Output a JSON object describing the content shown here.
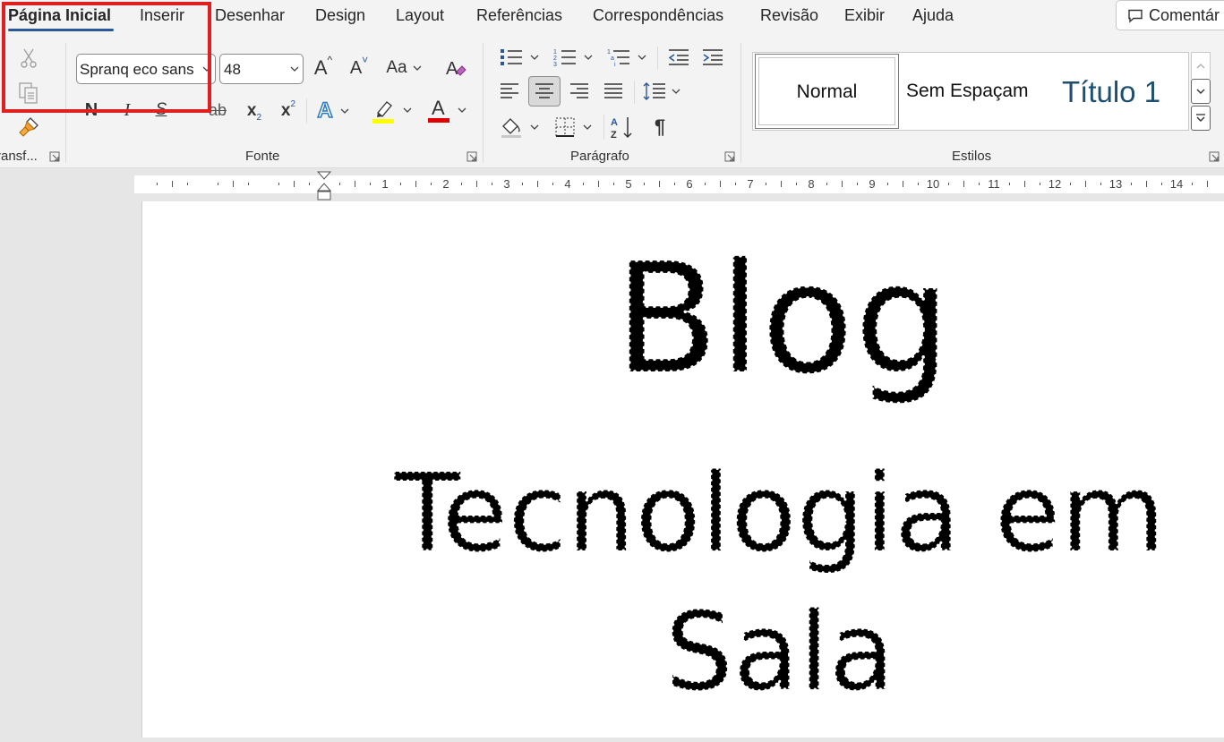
{
  "tabs": [
    {
      "label": "Página Inicial",
      "active": true
    },
    {
      "label": "Inserir"
    },
    {
      "label": "Desenhar"
    },
    {
      "label": "Design"
    },
    {
      "label": "Layout"
    },
    {
      "label": "Referências"
    },
    {
      "label": "Correspondências"
    },
    {
      "label": "Revisão"
    },
    {
      "label": "Exibir"
    },
    {
      "label": "Ajuda"
    }
  ],
  "comments_button": "Comentár",
  "groups": {
    "clipboard": "ransf...",
    "font": "Fonte",
    "paragraph": "Parágrafo",
    "styles": "Estilos"
  },
  "font": {
    "name": "Spranq eco sans",
    "size": "48",
    "grow": "A",
    "shrink": "A",
    "case": "Aa",
    "bold": "N",
    "italic": "I",
    "underline": "S",
    "strike": "ab",
    "subscript": "x",
    "superscript": "x",
    "text_effects": "A",
    "font_color": "A"
  },
  "styles": {
    "normal": "Normal",
    "no_spacing": "Sem Espaçam",
    "title1": "Título 1"
  },
  "ruler_numbers": [
    "1",
    "2",
    "3",
    "4",
    "5",
    "6",
    "7",
    "8",
    "9",
    "10",
    "11",
    "12",
    "13",
    "14"
  ],
  "document": {
    "line1": "Blog",
    "line2": "Tecnologia em",
    "line3": "Sala"
  },
  "colors": {
    "accent": "#2b579a",
    "highlight_box": "#e02020",
    "highlighter": "#ffff00",
    "font_color": "#e00000",
    "title1": "#1d4f6e"
  }
}
